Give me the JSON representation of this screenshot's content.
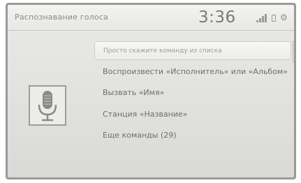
{
  "header": {
    "title": "Распознавание голоса",
    "time": "3:36"
  },
  "status": {
    "icons": [
      "signal-icon",
      "battery-icon",
      "settings-gear-icon"
    ]
  },
  "mic": {
    "icon": "microphone-icon"
  },
  "commands": [
    {
      "label": "Просто скажите команду из списка"
    },
    {
      "label": "Воспроизвести «Исполнитель» или «Альбом»"
    },
    {
      "label": "Вызвать «Имя»"
    },
    {
      "label": "Станция «Название»"
    },
    {
      "label": "Еще команды (29)"
    }
  ],
  "colors": {
    "bezel": "#9a9a98",
    "screen_bg": "#e3e3e1",
    "text": "#6e6e6c"
  }
}
